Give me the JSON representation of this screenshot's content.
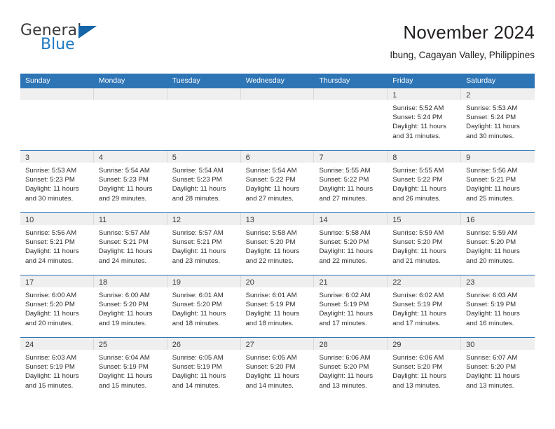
{
  "brand": {
    "name_top": "General",
    "name_bottom": "Blue",
    "flag_icon": "triangle-flag-icon",
    "color_blue": "#1f7ac4",
    "color_dark": "#3b3b3b"
  },
  "header": {
    "title": "November 2024",
    "subtitle": "Ibung, Cagayan Valley, Philippines"
  },
  "theme": {
    "header_blue": "#2e75b6",
    "day_band_gray": "#efefef",
    "text": "#231f20"
  },
  "weekdays": [
    "Sunday",
    "Monday",
    "Tuesday",
    "Wednesday",
    "Thursday",
    "Friday",
    "Saturday"
  ],
  "weeks": [
    [
      {
        "day": "",
        "sunrise": "",
        "sunset": "",
        "daylight_1": "",
        "daylight_2": ""
      },
      {
        "day": "",
        "sunrise": "",
        "sunset": "",
        "daylight_1": "",
        "daylight_2": ""
      },
      {
        "day": "",
        "sunrise": "",
        "sunset": "",
        "daylight_1": "",
        "daylight_2": ""
      },
      {
        "day": "",
        "sunrise": "",
        "sunset": "",
        "daylight_1": "",
        "daylight_2": ""
      },
      {
        "day": "",
        "sunrise": "",
        "sunset": "",
        "daylight_1": "",
        "daylight_2": ""
      },
      {
        "day": "1",
        "sunrise": "Sunrise: 5:52 AM",
        "sunset": "Sunset: 5:24 PM",
        "daylight_1": "Daylight: 11 hours",
        "daylight_2": "and 31 minutes."
      },
      {
        "day": "2",
        "sunrise": "Sunrise: 5:53 AM",
        "sunset": "Sunset: 5:24 PM",
        "daylight_1": "Daylight: 11 hours",
        "daylight_2": "and 30 minutes."
      }
    ],
    [
      {
        "day": "3",
        "sunrise": "Sunrise: 5:53 AM",
        "sunset": "Sunset: 5:23 PM",
        "daylight_1": "Daylight: 11 hours",
        "daylight_2": "and 30 minutes."
      },
      {
        "day": "4",
        "sunrise": "Sunrise: 5:54 AM",
        "sunset": "Sunset: 5:23 PM",
        "daylight_1": "Daylight: 11 hours",
        "daylight_2": "and 29 minutes."
      },
      {
        "day": "5",
        "sunrise": "Sunrise: 5:54 AM",
        "sunset": "Sunset: 5:23 PM",
        "daylight_1": "Daylight: 11 hours",
        "daylight_2": "and 28 minutes."
      },
      {
        "day": "6",
        "sunrise": "Sunrise: 5:54 AM",
        "sunset": "Sunset: 5:22 PM",
        "daylight_1": "Daylight: 11 hours",
        "daylight_2": "and 27 minutes."
      },
      {
        "day": "7",
        "sunrise": "Sunrise: 5:55 AM",
        "sunset": "Sunset: 5:22 PM",
        "daylight_1": "Daylight: 11 hours",
        "daylight_2": "and 27 minutes."
      },
      {
        "day": "8",
        "sunrise": "Sunrise: 5:55 AM",
        "sunset": "Sunset: 5:22 PM",
        "daylight_1": "Daylight: 11 hours",
        "daylight_2": "and 26 minutes."
      },
      {
        "day": "9",
        "sunrise": "Sunrise: 5:56 AM",
        "sunset": "Sunset: 5:21 PM",
        "daylight_1": "Daylight: 11 hours",
        "daylight_2": "and 25 minutes."
      }
    ],
    [
      {
        "day": "10",
        "sunrise": "Sunrise: 5:56 AM",
        "sunset": "Sunset: 5:21 PM",
        "daylight_1": "Daylight: 11 hours",
        "daylight_2": "and 24 minutes."
      },
      {
        "day": "11",
        "sunrise": "Sunrise: 5:57 AM",
        "sunset": "Sunset: 5:21 PM",
        "daylight_1": "Daylight: 11 hours",
        "daylight_2": "and 24 minutes."
      },
      {
        "day": "12",
        "sunrise": "Sunrise: 5:57 AM",
        "sunset": "Sunset: 5:21 PM",
        "daylight_1": "Daylight: 11 hours",
        "daylight_2": "and 23 minutes."
      },
      {
        "day": "13",
        "sunrise": "Sunrise: 5:58 AM",
        "sunset": "Sunset: 5:20 PM",
        "daylight_1": "Daylight: 11 hours",
        "daylight_2": "and 22 minutes."
      },
      {
        "day": "14",
        "sunrise": "Sunrise: 5:58 AM",
        "sunset": "Sunset: 5:20 PM",
        "daylight_1": "Daylight: 11 hours",
        "daylight_2": "and 22 minutes."
      },
      {
        "day": "15",
        "sunrise": "Sunrise: 5:59 AM",
        "sunset": "Sunset: 5:20 PM",
        "daylight_1": "Daylight: 11 hours",
        "daylight_2": "and 21 minutes."
      },
      {
        "day": "16",
        "sunrise": "Sunrise: 5:59 AM",
        "sunset": "Sunset: 5:20 PM",
        "daylight_1": "Daylight: 11 hours",
        "daylight_2": "and 20 minutes."
      }
    ],
    [
      {
        "day": "17",
        "sunrise": "Sunrise: 6:00 AM",
        "sunset": "Sunset: 5:20 PM",
        "daylight_1": "Daylight: 11 hours",
        "daylight_2": "and 20 minutes."
      },
      {
        "day": "18",
        "sunrise": "Sunrise: 6:00 AM",
        "sunset": "Sunset: 5:20 PM",
        "daylight_1": "Daylight: 11 hours",
        "daylight_2": "and 19 minutes."
      },
      {
        "day": "19",
        "sunrise": "Sunrise: 6:01 AM",
        "sunset": "Sunset: 5:20 PM",
        "daylight_1": "Daylight: 11 hours",
        "daylight_2": "and 18 minutes."
      },
      {
        "day": "20",
        "sunrise": "Sunrise: 6:01 AM",
        "sunset": "Sunset: 5:19 PM",
        "daylight_1": "Daylight: 11 hours",
        "daylight_2": "and 18 minutes."
      },
      {
        "day": "21",
        "sunrise": "Sunrise: 6:02 AM",
        "sunset": "Sunset: 5:19 PM",
        "daylight_1": "Daylight: 11 hours",
        "daylight_2": "and 17 minutes."
      },
      {
        "day": "22",
        "sunrise": "Sunrise: 6:02 AM",
        "sunset": "Sunset: 5:19 PM",
        "daylight_1": "Daylight: 11 hours",
        "daylight_2": "and 17 minutes."
      },
      {
        "day": "23",
        "sunrise": "Sunrise: 6:03 AM",
        "sunset": "Sunset: 5:19 PM",
        "daylight_1": "Daylight: 11 hours",
        "daylight_2": "and 16 minutes."
      }
    ],
    [
      {
        "day": "24",
        "sunrise": "Sunrise: 6:03 AM",
        "sunset": "Sunset: 5:19 PM",
        "daylight_1": "Daylight: 11 hours",
        "daylight_2": "and 15 minutes."
      },
      {
        "day": "25",
        "sunrise": "Sunrise: 6:04 AM",
        "sunset": "Sunset: 5:19 PM",
        "daylight_1": "Daylight: 11 hours",
        "daylight_2": "and 15 minutes."
      },
      {
        "day": "26",
        "sunrise": "Sunrise: 6:05 AM",
        "sunset": "Sunset: 5:19 PM",
        "daylight_1": "Daylight: 11 hours",
        "daylight_2": "and 14 minutes."
      },
      {
        "day": "27",
        "sunrise": "Sunrise: 6:05 AM",
        "sunset": "Sunset: 5:20 PM",
        "daylight_1": "Daylight: 11 hours",
        "daylight_2": "and 14 minutes."
      },
      {
        "day": "28",
        "sunrise": "Sunrise: 6:06 AM",
        "sunset": "Sunset: 5:20 PM",
        "daylight_1": "Daylight: 11 hours",
        "daylight_2": "and 13 minutes."
      },
      {
        "day": "29",
        "sunrise": "Sunrise: 6:06 AM",
        "sunset": "Sunset: 5:20 PM",
        "daylight_1": "Daylight: 11 hours",
        "daylight_2": "and 13 minutes."
      },
      {
        "day": "30",
        "sunrise": "Sunrise: 6:07 AM",
        "sunset": "Sunset: 5:20 PM",
        "daylight_1": "Daylight: 11 hours",
        "daylight_2": "and 13 minutes."
      }
    ]
  ]
}
